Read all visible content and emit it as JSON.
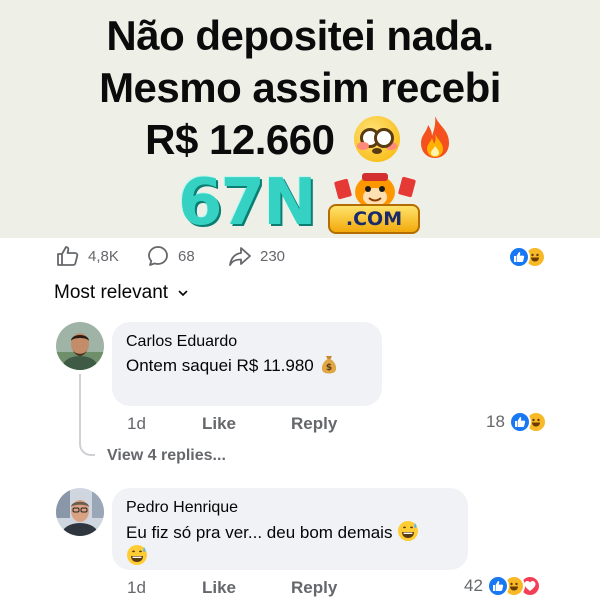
{
  "hero": {
    "line1": "Não depositei nada.",
    "line2": "Mesmo assim recebi",
    "line3": "R$ 12.660",
    "emojis": [
      "flushed-face",
      "fire"
    ],
    "logo_number": "67N",
    "logo_domain": ".COM",
    "background": "#eef0e8"
  },
  "post_stats": {
    "likes": "4,8K",
    "comments": "68",
    "shares": "230",
    "reactions": [
      "like",
      "haha"
    ]
  },
  "sort": {
    "label": "Most relevant"
  },
  "comments": [
    {
      "author": "Carlos Eduardo",
      "text": "Ontem saquei R$ 11.980",
      "emoji": "money-bag",
      "time": "1d",
      "like_label": "Like",
      "reply_label": "Reply",
      "reaction_count": "18",
      "reactions": [
        "like",
        "haha"
      ],
      "view_replies": "View 4 replies..."
    },
    {
      "author": "Pedro Henrique",
      "text": "Eu fiz só pra ver... deu bom demais",
      "emoji": "grinning-sweat",
      "time": "1d",
      "like_label": "Like",
      "reply_label": "Reply",
      "reaction_count": "42",
      "reactions": [
        "like",
        "haha",
        "love"
      ]
    }
  ],
  "colors": {
    "facebook_blue": "#1877f2",
    "haha_yellow": "#f7b928",
    "love_red": "#f33e58",
    "bubble_gray": "#f0f2f5",
    "meta_gray": "#65676b"
  }
}
